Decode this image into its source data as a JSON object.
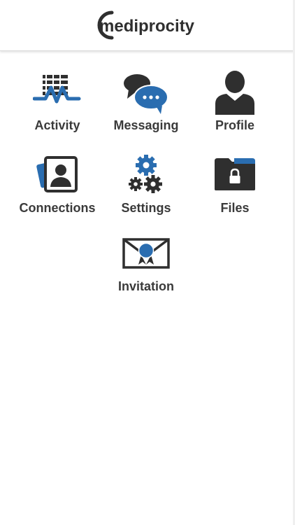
{
  "brand": {
    "logo_text": "mediprocity",
    "primary_color": "#2a6db0",
    "dark_color": "#2f2f2f"
  },
  "menu": {
    "items": [
      {
        "label": "Activity",
        "icon": "activity-chart-icon"
      },
      {
        "label": "Messaging",
        "icon": "chat-bubbles-icon"
      },
      {
        "label": "Profile",
        "icon": "person-icon"
      },
      {
        "label": "Connections",
        "icon": "contact-cards-icon"
      },
      {
        "label": "Settings",
        "icon": "gears-icon"
      },
      {
        "label": "Files",
        "icon": "locked-folder-icon"
      },
      {
        "label": "Invitation",
        "icon": "sealed-envelope-icon"
      }
    ]
  }
}
